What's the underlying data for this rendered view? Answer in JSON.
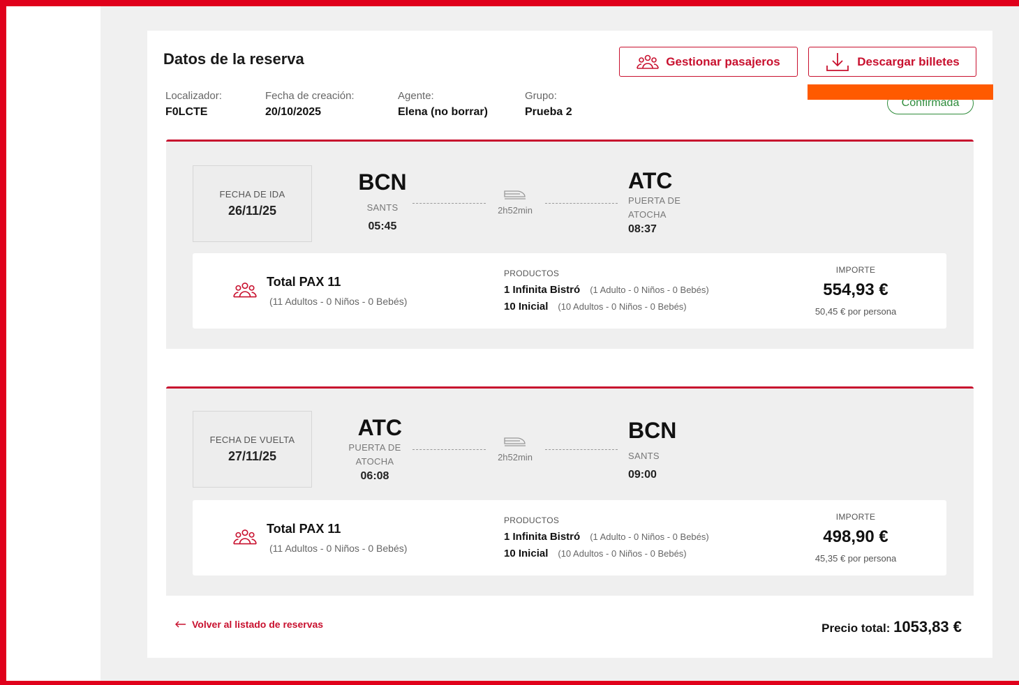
{
  "booking": {
    "title": "Datos de la reserva",
    "manage_label": "Gestionar pasajeros",
    "download_label": "Descargar billetes",
    "status": "Confirmada",
    "meta": [
      {
        "label": "Localizador:",
        "value": "F0LCTE"
      },
      {
        "label": "Fecha de creación:",
        "value": "20/10/2025"
      },
      {
        "label": "Agente:",
        "value": "Elena (no borrar)"
      },
      {
        "label": "Grupo:",
        "value": "Prueba 2"
      }
    ]
  },
  "trips": [
    {
      "date_label": "FECHA DE IDA",
      "date": "26/11/25",
      "origin": {
        "code": "BCN",
        "name": "SANTS",
        "time": "05:45"
      },
      "destination": {
        "code": "ATC",
        "name_line1": "PUERTA DE",
        "name_line2": "ATOCHA",
        "time": "08:37"
      },
      "duration": "2h52min",
      "pax_title": "Total PAX 11",
      "pax_detail": "(11 Adultos - 0 Niños - 0 Bebés)",
      "products_label": "PRODUCTOS",
      "products": [
        {
          "name": "1 Infinita Bistró",
          "detail": "(1 Adulto - 0 Niños - 0 Bebés)"
        },
        {
          "name": "10 Inicial",
          "detail": "(10 Adultos - 0 Niños - 0 Bebés)"
        }
      ],
      "amount_label": "IMPORTE",
      "amount": "554,93 €",
      "per_person": "50,45 € por persona"
    },
    {
      "date_label": "FECHA DE VUELTA",
      "date": "27/11/25",
      "origin": {
        "code": "ATC",
        "name_line1": "PUERTA DE",
        "name_line2": "ATOCHA",
        "time": "06:08"
      },
      "destination": {
        "code": "BCN",
        "name": "SANTS",
        "time": "09:00"
      },
      "duration": "2h52min",
      "pax_title": "Total PAX 11",
      "pax_detail": "(11 Adultos - 0 Niños - 0 Bebés)",
      "products_label": "PRODUCTOS",
      "products": [
        {
          "name": "1 Infinita Bistró",
          "detail": "(1 Adulto - 0 Niños - 0 Bebés)"
        },
        {
          "name": "10 Inicial",
          "detail": "(10 Adultos - 0 Niños - 0 Bebés)"
        }
      ],
      "amount_label": "IMPORTE",
      "amount": "498,90 €",
      "per_person": "45,35 € por persona"
    }
  ],
  "footer": {
    "back_label": "Volver al listado de reservas",
    "total_label": "Precio total:",
    "total_amount": "1053,83 €"
  },
  "colors": {
    "brand": "#c8102e",
    "status": "#2e8b3a",
    "highlight": "#ff5a00"
  },
  "icons": [
    "group-icon",
    "download-icon",
    "train-icon",
    "arrow-left-icon"
  ]
}
